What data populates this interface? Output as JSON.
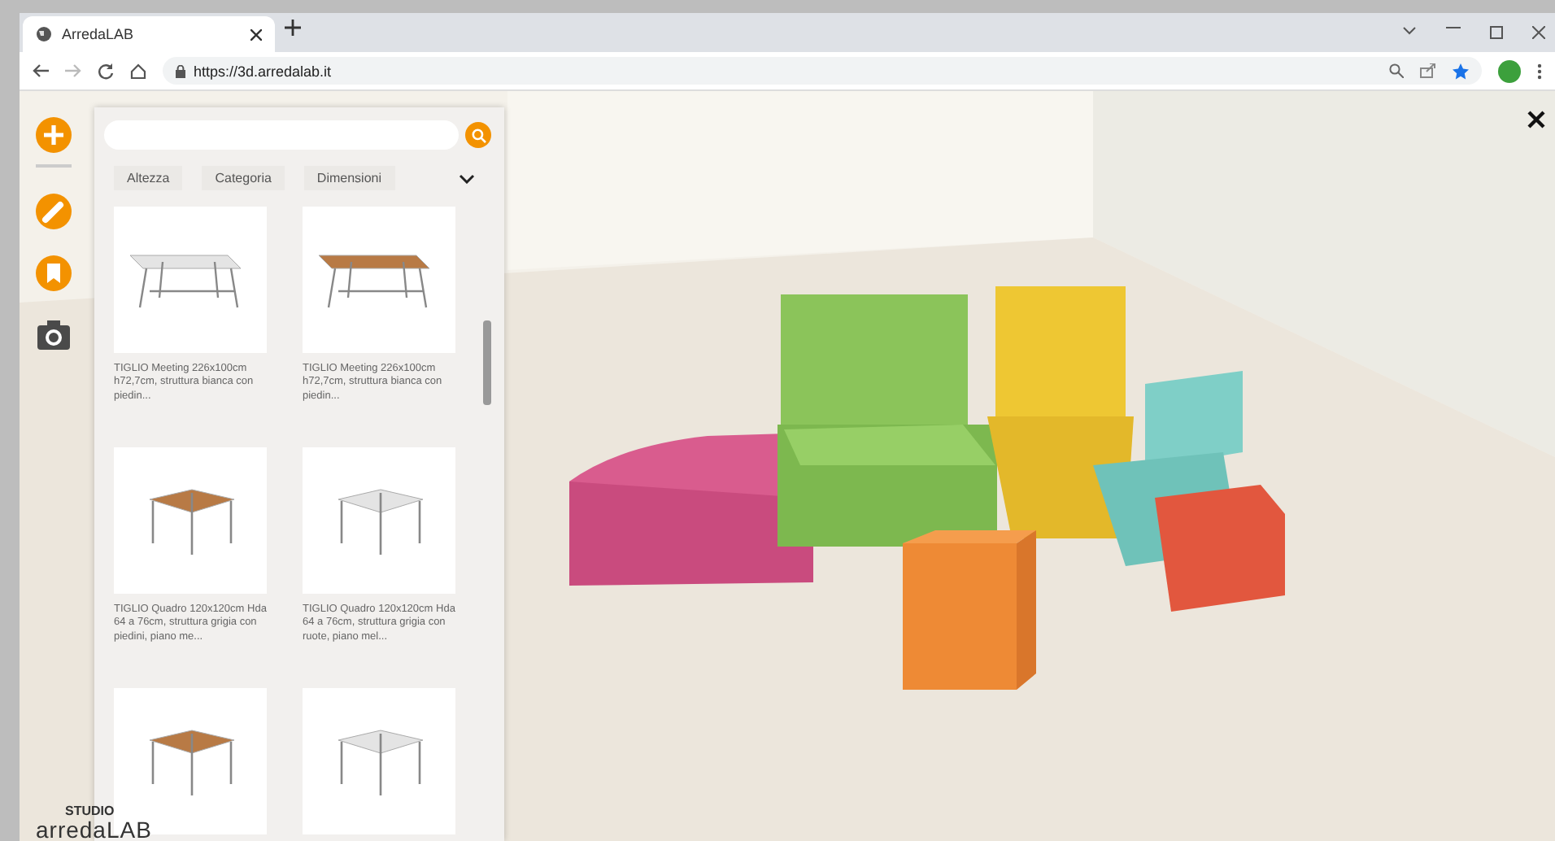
{
  "browser": {
    "tab": {
      "title": "ArredaLAB"
    },
    "url": "https://3d.arredalab.it"
  },
  "tools": [
    {
      "kind": "add",
      "selected": true
    },
    {
      "kind": "edit",
      "selected": false
    },
    {
      "kind": "bookmark",
      "selected": false
    },
    {
      "kind": "camera",
      "selected": false
    }
  ],
  "filters": [
    "Altezza",
    "Categoria",
    "Dimensioni"
  ],
  "products": [
    {
      "kind": "white-meeting",
      "name": "TIGLIO Meeting 226x100cm h72,7cm, struttura bianca con piedin..."
    },
    {
      "kind": "wood-meeting",
      "name": "TIGLIO Meeting 226x100cm h72,7cm, struttura bianca con piedin..."
    },
    {
      "kind": "wood-square",
      "name": "TIGLIO Quadro 120x120cm Hda 64 a 76cm, struttura grigia con piedini, piano me..."
    },
    {
      "kind": "white-square",
      "name": "TIGLIO Quadro 120x120cm Hda 64 a 76cm, struttura grigia con ruote, piano mel..."
    },
    {
      "kind": "wood-square"
    },
    {
      "kind": "white-square"
    }
  ],
  "logo": {
    "top": "STUDIO",
    "bottom": "arredaLAB"
  }
}
